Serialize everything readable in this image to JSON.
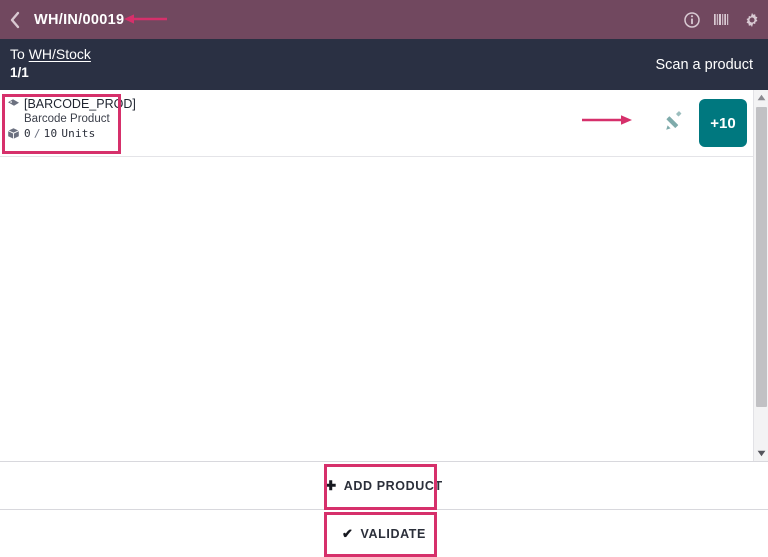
{
  "header": {
    "back_icon": "chevron-left-icon",
    "title": "WH/IN/00019",
    "icons": [
      {
        "name": "info-icon",
        "label": "Information"
      },
      {
        "name": "barcode-icon",
        "label": "Barcode"
      },
      {
        "name": "gear-icon",
        "label": "Settings"
      }
    ]
  },
  "subheader": {
    "destination_prefix": "To",
    "destination": "WH/Stock",
    "page_count": "1/1",
    "scan_hint": "Scan a product"
  },
  "lines": [
    {
      "tag_icon": "tag-icon",
      "code": "[BARCODE_PROD]",
      "name": "Barcode Product",
      "qty_icon": "package-icon",
      "qty_done": "0",
      "qty_separator": "/",
      "qty_total": "10",
      "uom": "Units",
      "edit_icon": "pencil-icon",
      "increment_label": "+10"
    }
  ],
  "footer": {
    "add_product": {
      "glyph": "➕",
      "label": "ADD PRODUCT"
    },
    "validate": {
      "glyph": "✔",
      "label": "VALIDATE"
    }
  },
  "scrollbar": {
    "up_icon": "scroll-up-arrow-icon",
    "down_icon": "scroll-down-arrow-icon",
    "thumb": "scroll-thumb"
  },
  "colors": {
    "header_purple": "#71485F",
    "subheader_navy": "#2A3043",
    "accent_teal": "#00787F",
    "annotation_pink": "#D6306B",
    "pencil_teal": "#7FABAB"
  },
  "annotations": [
    {
      "name": "title-arrow",
      "type": "arrow"
    },
    {
      "name": "product-card-box",
      "type": "box"
    },
    {
      "name": "edit-arrow",
      "type": "arrow"
    },
    {
      "name": "add-product-box",
      "type": "box"
    },
    {
      "name": "validate-box",
      "type": "box"
    }
  ]
}
